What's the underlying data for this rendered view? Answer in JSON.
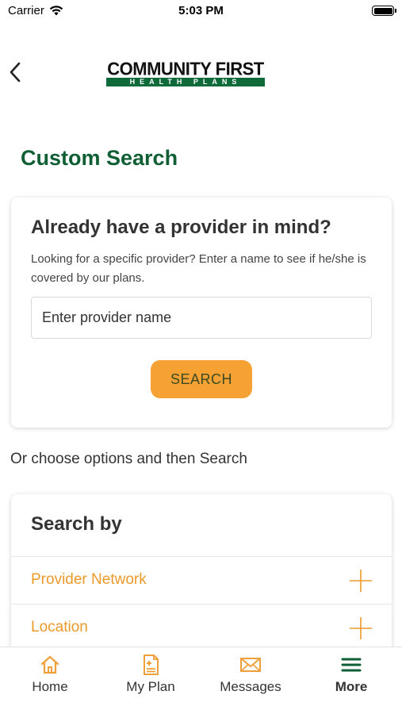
{
  "status_bar": {
    "carrier": "Carrier",
    "time": "5:03 PM"
  },
  "header": {
    "logo_top": "COMMUNITY FIRST",
    "logo_bottom": "HEALTH PLANS",
    "back_icon": "chevron-left-icon"
  },
  "page": {
    "title": "Custom Search"
  },
  "provider_card": {
    "title": "Already have a provider in mind?",
    "description": "Looking for a specific provider? Enter a name to see if he/she is covered by our plans.",
    "input_placeholder": "Enter provider name",
    "input_value": "",
    "search_label": "SEARCH"
  },
  "or_text": "Or choose options and then Search",
  "search_by": {
    "title": "Search by",
    "options": [
      {
        "label": "Provider Network",
        "icon": "plus-icon"
      },
      {
        "label": "Location",
        "icon": "plus-icon"
      }
    ]
  },
  "tab_bar": {
    "tabs": [
      {
        "label": "Home",
        "icon": "home-icon",
        "active": false
      },
      {
        "label": "My Plan",
        "icon": "document-icon",
        "active": false
      },
      {
        "label": "Messages",
        "icon": "envelope-icon",
        "active": false
      },
      {
        "label": "More",
        "icon": "menu-icon",
        "active": true
      }
    ]
  },
  "colors": {
    "brand_green": "#0f5e34",
    "accent_orange": "#f6a133",
    "option_orange": "#eb9a2a",
    "tab_icon_orange": "#f0a03a",
    "text_dark": "#333333"
  }
}
